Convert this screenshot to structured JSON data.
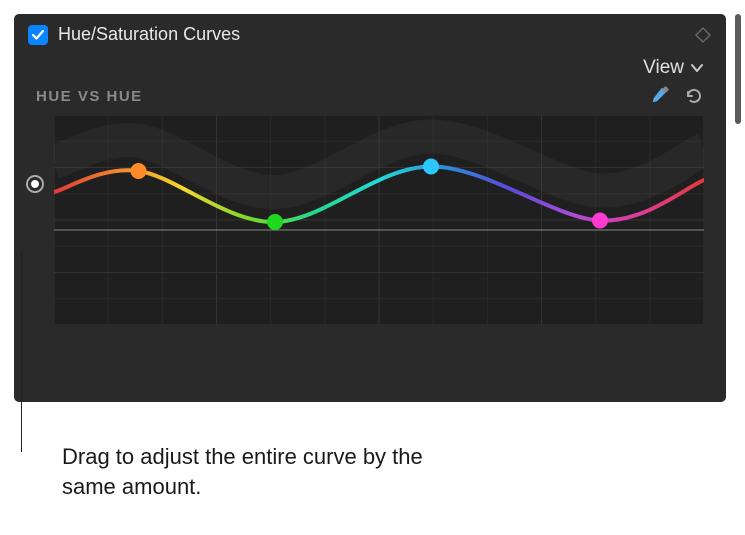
{
  "panel": {
    "enabled": true,
    "title": "Hue/Saturation Curves"
  },
  "toolbar": {
    "view_label": "View"
  },
  "graph": {
    "label": "HUE VS HUE",
    "icons": {
      "eyedropper": "eyedropper-icon",
      "reset": "reset-icon"
    },
    "points": [
      {
        "x": 0.13,
        "y": 0.24,
        "color": "#ff8a2a"
      },
      {
        "x": 0.34,
        "y": 0.58,
        "color": "#1fd81f"
      },
      {
        "x": 0.58,
        "y": 0.21,
        "color": "#2bc7ff"
      },
      {
        "x": 0.84,
        "y": 0.57,
        "color": "#ff3ad1"
      }
    ],
    "rainbow_stops": [
      {
        "off": 0.0,
        "c": "#e03a3a"
      },
      {
        "off": 0.1,
        "c": "#f28a2d"
      },
      {
        "off": 0.2,
        "c": "#f2d82d"
      },
      {
        "off": 0.3,
        "c": "#7ad82d"
      },
      {
        "off": 0.4,
        "c": "#24d88a"
      },
      {
        "off": 0.5,
        "c": "#24d8d8"
      },
      {
        "off": 0.6,
        "c": "#2b8fd8"
      },
      {
        "off": 0.7,
        "c": "#5a4ad8"
      },
      {
        "off": 0.8,
        "c": "#b04ad8"
      },
      {
        "off": 0.9,
        "c": "#e03a9a"
      },
      {
        "off": 1.0,
        "c": "#e03a3a"
      }
    ]
  },
  "callout": {
    "text": "Drag to adjust the entire curve by the same amount."
  },
  "colors": {
    "accent": "#0a84ff"
  }
}
